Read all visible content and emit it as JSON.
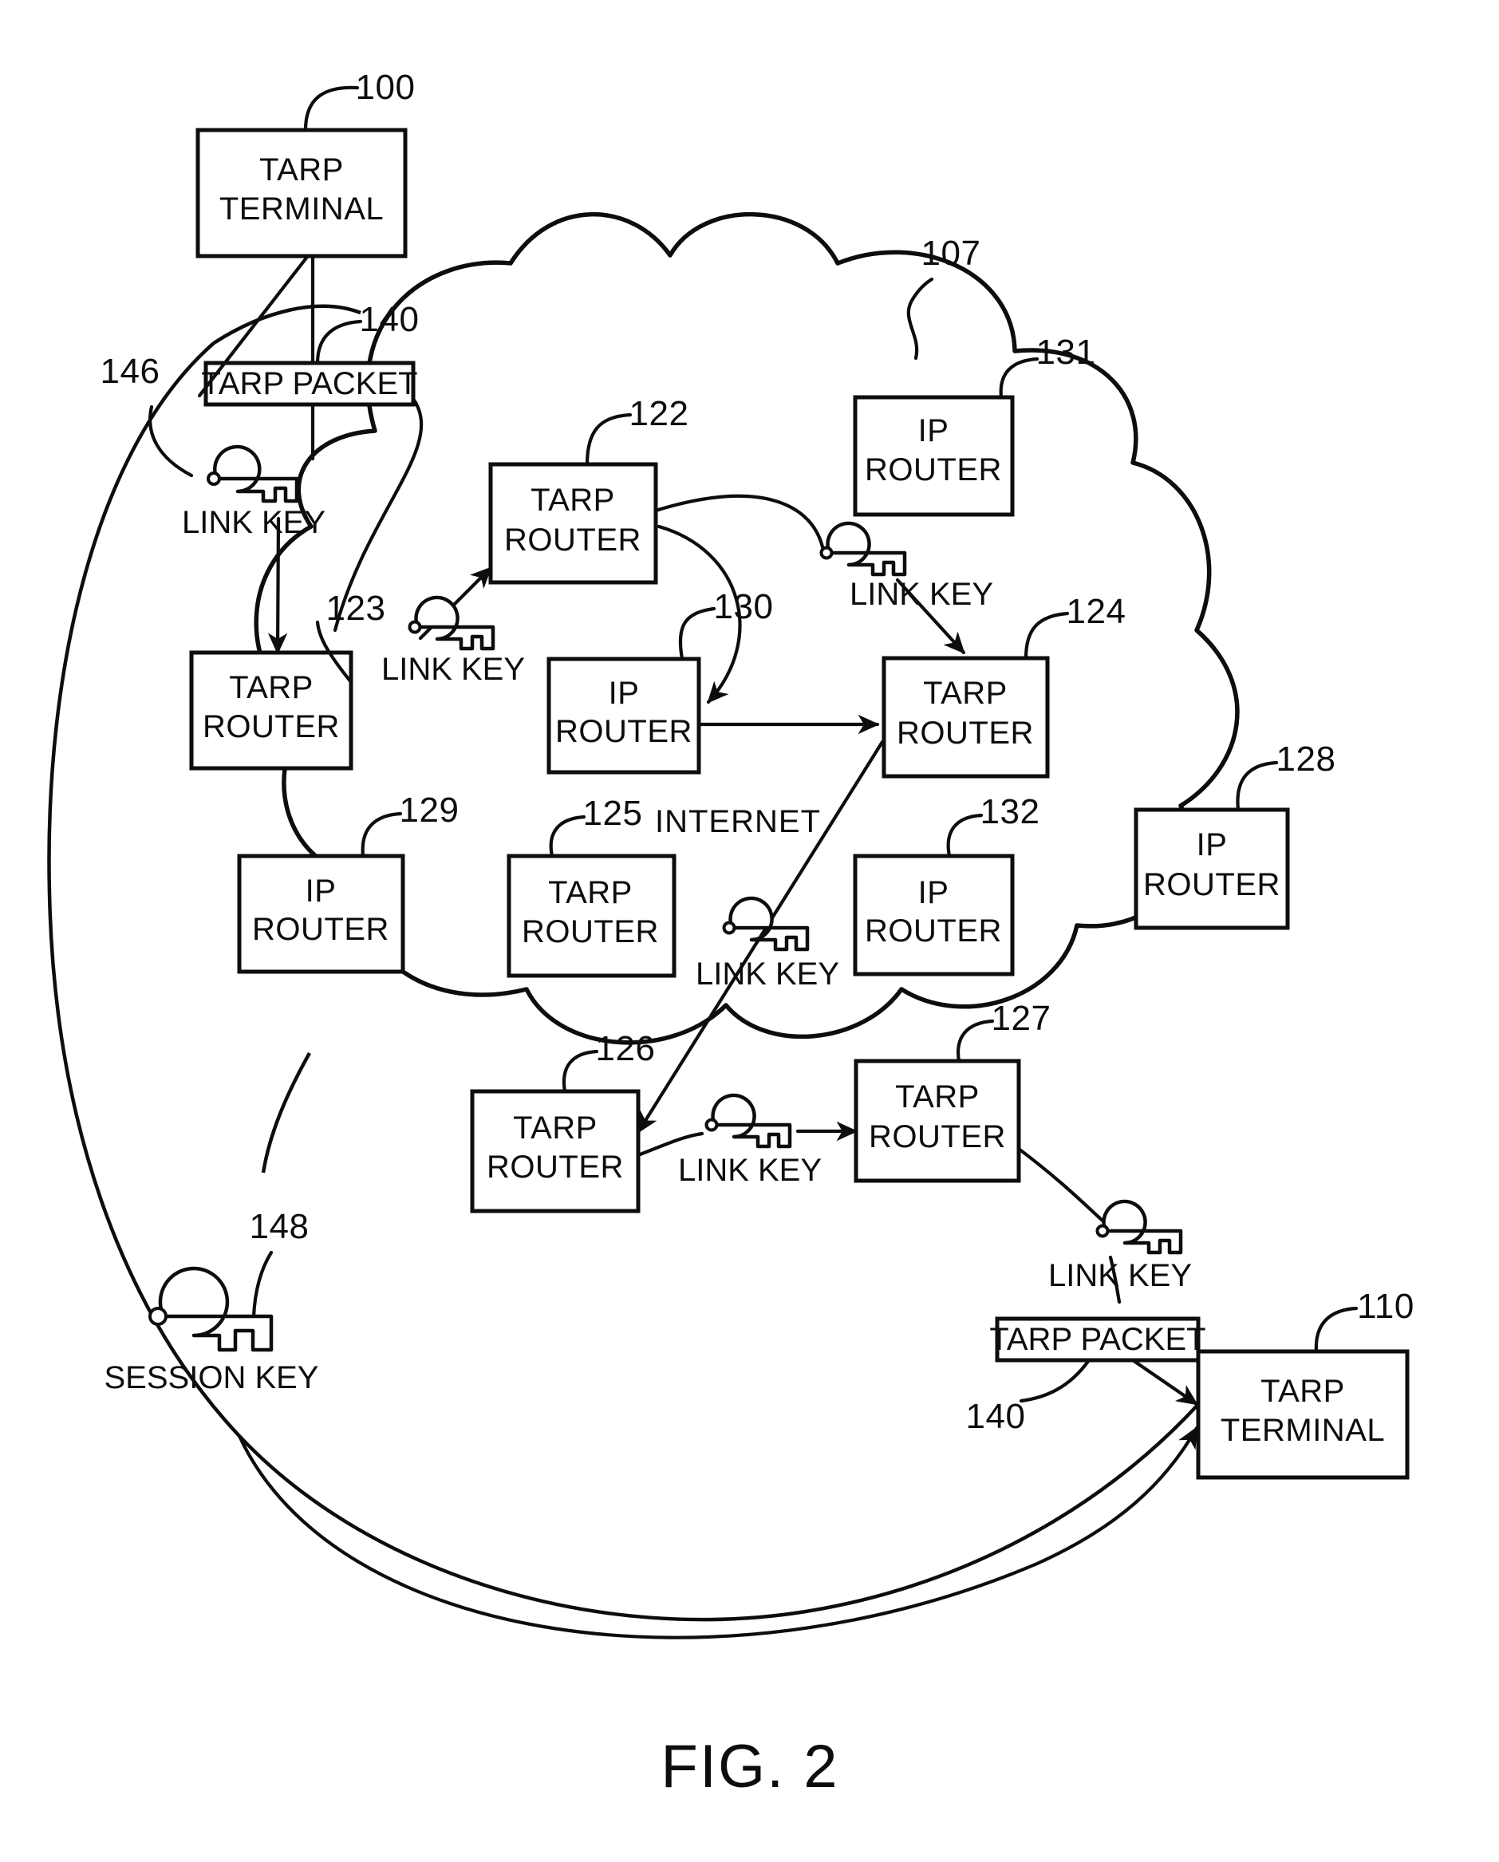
{
  "figure": {
    "caption": "FIG. 2",
    "cloud_label": "INTERNET"
  },
  "nodes": [
    {
      "id": "n100",
      "ref": "100",
      "line1": "TARP",
      "line2": "TERMINAL",
      "kind": "tarp-terminal"
    },
    {
      "id": "n122",
      "ref": "122",
      "line1": "TARP",
      "line2": "ROUTER",
      "kind": "tarp-router"
    },
    {
      "id": "n123",
      "ref": "123",
      "line1": "TARP",
      "line2": "ROUTER",
      "kind": "tarp-router"
    },
    {
      "id": "n124",
      "ref": "124",
      "line1": "TARP",
      "line2": "ROUTER",
      "kind": "tarp-router"
    },
    {
      "id": "n125",
      "ref": "125",
      "line1": "TARP",
      "line2": "ROUTER",
      "kind": "tarp-router"
    },
    {
      "id": "n126",
      "ref": "126",
      "line1": "TARP",
      "line2": "ROUTER",
      "kind": "tarp-router"
    },
    {
      "id": "n127",
      "ref": "127",
      "line1": "TARP",
      "line2": "ROUTER",
      "kind": "tarp-router"
    },
    {
      "id": "n128",
      "ref": "128",
      "line1": "IP",
      "line2": "ROUTER",
      "kind": "ip-router"
    },
    {
      "id": "n129",
      "ref": "129",
      "line1": "IP",
      "line2": "ROUTER",
      "kind": "ip-router"
    },
    {
      "id": "n130",
      "ref": "130",
      "line1": "IP",
      "line2": "ROUTER",
      "kind": "ip-router"
    },
    {
      "id": "n131",
      "ref": "131",
      "line1": "IP",
      "line2": "ROUTER",
      "kind": "ip-router"
    },
    {
      "id": "n132",
      "ref": "132",
      "line1": "IP",
      "line2": "ROUTER",
      "kind": "ip-router"
    },
    {
      "id": "n110",
      "ref": "110",
      "line1": "TARP",
      "line2": "TERMINAL",
      "kind": "tarp-terminal"
    }
  ],
  "packets": [
    {
      "id": "p140top",
      "ref": "140",
      "label": "TARP PACKET"
    },
    {
      "id": "p140bottom",
      "ref": "140",
      "label": "TARP PACKET"
    }
  ],
  "keys": [
    {
      "id": "k146",
      "ref": "146",
      "label": "LINK KEY",
      "kind": "link-key"
    },
    {
      "id": "k123",
      "ref": "",
      "label": "LINK KEY",
      "kind": "link-key"
    },
    {
      "id": "k131",
      "ref": "",
      "label": "LINK KEY",
      "kind": "link-key"
    },
    {
      "id": "kmid",
      "ref": "",
      "label": "LINK KEY",
      "kind": "link-key"
    },
    {
      "id": "k127",
      "ref": "",
      "label": "LINK KEY",
      "kind": "link-key"
    },
    {
      "id": "k110",
      "ref": "",
      "label": "LINK KEY",
      "kind": "link-key"
    },
    {
      "id": "k148",
      "ref": "148",
      "label": "SESSION KEY",
      "kind": "session-key"
    }
  ],
  "cloud_refs": [
    {
      "id": "r107",
      "ref": "107"
    }
  ],
  "colors": {
    "ink": "#0d0d0d",
    "paper": "#ffffff"
  }
}
